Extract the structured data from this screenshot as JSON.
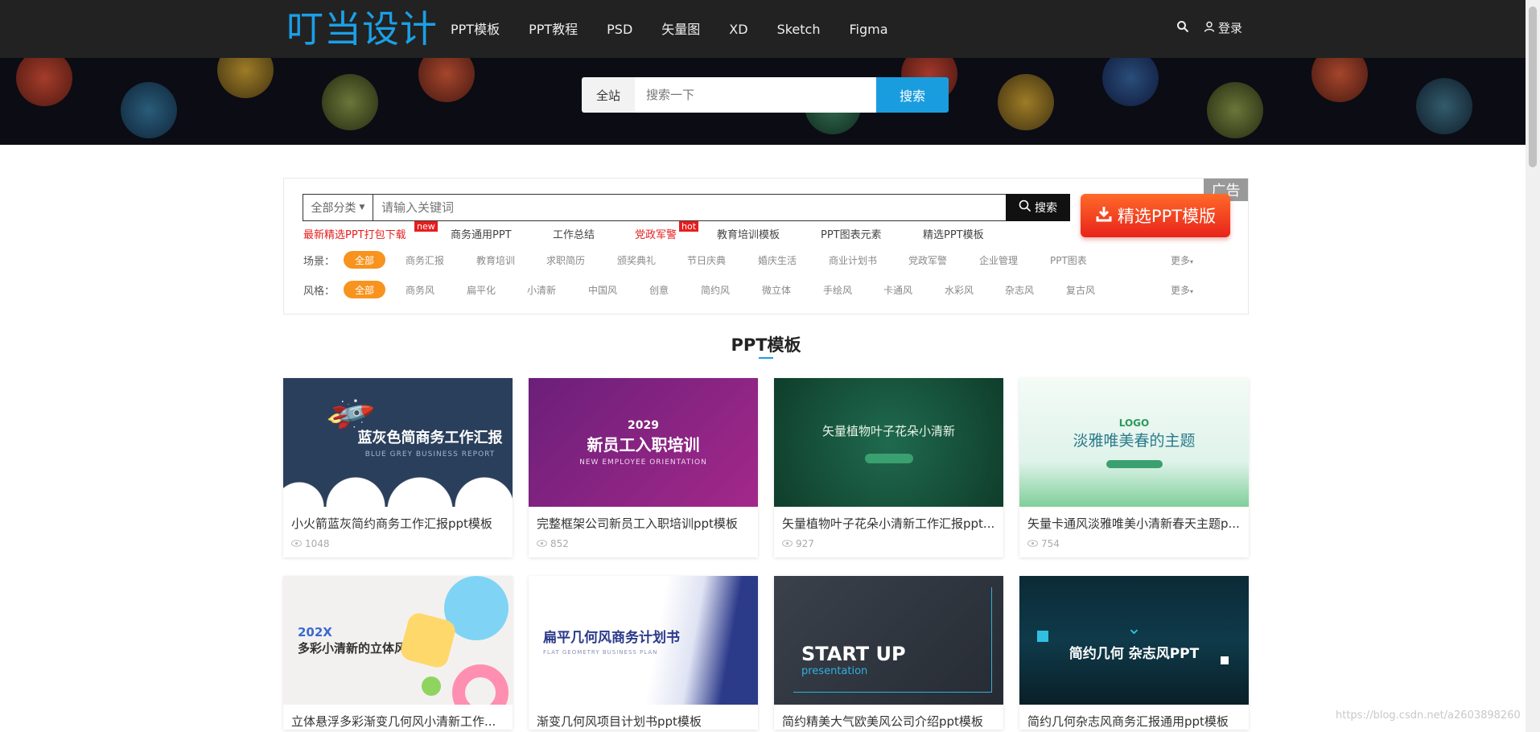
{
  "header": {
    "logo": "叮当设计",
    "nav": [
      "PPT模板",
      "PPT教程",
      "PSD",
      "矢量图",
      "XD",
      "Sketch",
      "Figma"
    ],
    "login": "登录"
  },
  "banner_search": {
    "scope": "全站",
    "placeholder": "搜索一下",
    "button": "搜索"
  },
  "filter": {
    "ad_label": "广告",
    "category_select": "全部分类",
    "keyword_placeholder": "请输入关键词",
    "search_button": "搜索",
    "promo_button": "精选PPT模版",
    "hot_links": [
      {
        "label": "最新精选PPT打包下载",
        "badge": "new",
        "red": true
      },
      {
        "label": "商务通用PPT",
        "badge": "",
        "red": false
      },
      {
        "label": "工作总结",
        "badge": "",
        "red": false
      },
      {
        "label": "党政军警",
        "badge": "hot",
        "red": true
      },
      {
        "label": "教育培训模板",
        "badge": "",
        "red": false
      },
      {
        "label": "PPT图表元素",
        "badge": "",
        "red": false
      },
      {
        "label": "精选PPT模板",
        "badge": "",
        "red": false
      }
    ],
    "scene": {
      "label": "场景：",
      "all": "全部",
      "options": [
        "商务汇报",
        "教育培训",
        "求职简历",
        "颁奖典礼",
        "节日庆典",
        "婚庆生活",
        "商业计划书",
        "党政军警",
        "企业管理",
        "PPT图表"
      ],
      "more": "更多"
    },
    "style": {
      "label": "风格：",
      "all": "全部",
      "options": [
        "商务风",
        "扁平化",
        "小清新",
        "中国风",
        "创意",
        "简约风",
        "微立体",
        "手绘风",
        "卡通风",
        "水彩风",
        "杂志风",
        "复古风"
      ],
      "more": "更多"
    }
  },
  "section": {
    "title": "PPT模板"
  },
  "cards": [
    {
      "title": "小火箭蓝灰简约商务工作汇报ppt模板",
      "views": "1048",
      "thumb_title": "蓝灰色简商务工作汇报",
      "thumb_sub": "BLUE GREY BUSINESS REPORT"
    },
    {
      "title": "完整框架公司新员工入职培训ppt模板",
      "views": "852",
      "thumb_title": "新员工入职培训",
      "thumb_sub": "NEW EMPLOYEE ORIENTATION",
      "thumb_year": "2029"
    },
    {
      "title": "矢量植物叶子花朵小清新工作汇报ppt...",
      "views": "927",
      "thumb_title": "矢量植物叶子花朵小清新",
      "thumb_sub": ""
    },
    {
      "title": "矢量卡通风淡雅唯美小清新春天主题p...",
      "views": "754",
      "thumb_title": "淡雅唯美春的主题",
      "thumb_sub": "LOGO"
    },
    {
      "title": "立体悬浮多彩渐变几何风小清新工作...",
      "views": "",
      "thumb_title": "多彩小清新的立体风",
      "thumb_sub": "202X"
    },
    {
      "title": "渐变几何风项目计划书ppt模板",
      "views": "",
      "thumb_title": "扁平几何风商务计划书",
      "thumb_sub": "FLAT GEOMETRY BUSINESS PLAN"
    },
    {
      "title": "简约精美大气欧美风公司介绍ppt模板",
      "views": "",
      "thumb_title": "START UP",
      "thumb_sub": "presentation"
    },
    {
      "title": "简约几何杂志风商务汇报通用ppt模板",
      "views": "",
      "thumb_title": "简约几何 杂志风PPT",
      "thumb_sub": ""
    }
  ],
  "watermark": "https://blog.csdn.net/a2603898260",
  "colors": {
    "accent": "#1a9ddf",
    "orange": "#f7931e",
    "red": "#e61e1e",
    "nav_bg": "#222222"
  }
}
